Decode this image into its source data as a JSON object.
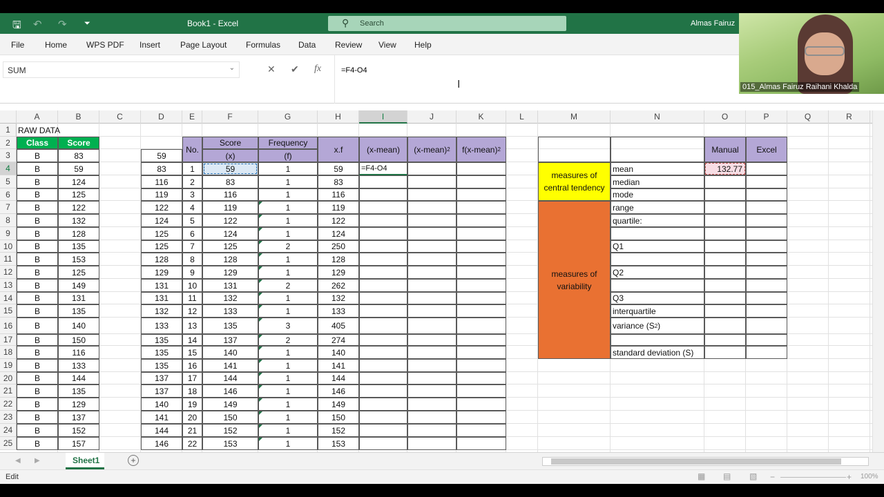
{
  "titlebar": {
    "title": "Book1  -  Excel",
    "search_placeholder": "Search",
    "user": "Almas Fairuz",
    "icons": [
      "save-icon",
      "undo-icon",
      "redo-icon",
      "customize-icon"
    ]
  },
  "menu": [
    "File",
    "Home",
    "WPS PDF",
    "Insert",
    "Page Layout",
    "Formulas",
    "Data",
    "Review",
    "View",
    "Help"
  ],
  "formula_bar": {
    "name_box": "SUM",
    "cancel": "✕",
    "enter": "✔",
    "fx": "fx",
    "formula": "=F4-O4"
  },
  "webcam": {
    "caption": "015_Almas Fairuz Raihani Khalda"
  },
  "columns": [
    "A",
    "B",
    "C",
    "D",
    "E",
    "F",
    "G",
    "H",
    "I",
    "J",
    "K",
    "L",
    "M",
    "N",
    "O",
    "P",
    "Q",
    "R"
  ],
  "selected_column": "I",
  "rows": [
    "1",
    "2",
    "3",
    "4",
    "5",
    "6",
    "7",
    "8",
    "9",
    "10",
    "11",
    "12",
    "13",
    "14",
    "15",
    "16",
    "17",
    "18",
    "19",
    "20",
    "21",
    "22",
    "23",
    "24",
    "25"
  ],
  "selected_row": "4",
  "raw": {
    "title": "RAW DATA",
    "class_header": "Class",
    "score_header": "Score",
    "classes": [
      "B",
      "B",
      "B",
      "B",
      "B",
      "B",
      "B",
      "B",
      "B",
      "B",
      "B",
      "B",
      "B",
      "B",
      "B",
      "B",
      "B",
      "B",
      "B",
      "B",
      "B",
      "B",
      "B"
    ],
    "scores": [
      "83",
      "59",
      "124",
      "125",
      "122",
      "132",
      "128",
      "135",
      "153",
      "125",
      "149",
      "131",
      "135",
      "140",
      "150",
      "116",
      "133",
      "144",
      "135",
      "129",
      "137",
      "152",
      "157"
    ]
  },
  "sorted": [
    "59",
    "83",
    "116",
    "119",
    "122",
    "124",
    "125",
    "125",
    "128",
    "129",
    "131",
    "131",
    "132",
    "133",
    "135",
    "135",
    "135",
    "137",
    "137",
    "140",
    "141",
    "144",
    "146"
  ],
  "freq": {
    "h_no": "No.",
    "h_score": "Score",
    "h_x": "(x)",
    "h_freq": "Frequency",
    "h_f": "(f)",
    "h_xf": "x.f",
    "h_xmean": "(x-mean)",
    "h_xmean2": "(x-mean)",
    "h_fxmean2": "f(x-mean)",
    "sup2": "2",
    "no": [
      "1",
      "2",
      "3",
      "4",
      "5",
      "6",
      "7",
      "8",
      "9",
      "10",
      "11",
      "12",
      "13",
      "14",
      "15",
      "16",
      "17",
      "18",
      "19",
      "20",
      "21",
      "22"
    ],
    "x": [
      "59",
      "83",
      "116",
      "119",
      "122",
      "124",
      "125",
      "128",
      "129",
      "131",
      "132",
      "133",
      "135",
      "137",
      "140",
      "141",
      "144",
      "146",
      "149",
      "150",
      "152",
      "153"
    ],
    "f": [
      "1",
      "1",
      "1",
      "1",
      "1",
      "1",
      "2",
      "1",
      "1",
      "2",
      "1",
      "1",
      "3",
      "2",
      "1",
      "1",
      "1",
      "1",
      "1",
      "1",
      "1",
      "1"
    ],
    "xf": [
      "59",
      "83",
      "116",
      "119",
      "122",
      "124",
      "250",
      "128",
      "129",
      "262",
      "132",
      "133",
      "405",
      "274",
      "140",
      "141",
      "144",
      "146",
      "149",
      "150",
      "152",
      "153"
    ],
    "active_cell": "=F4-O4"
  },
  "stats": {
    "h_manual": "Manual",
    "h_excel": "Excel",
    "central": "measures of central tendency",
    "variability": "measures of variability",
    "mean": "mean",
    "median": "median",
    "mode": "mode",
    "range": "range",
    "quartile": "quartile:",
    "q1": "Q1",
    "q2": "Q2",
    "q3": "Q3",
    "interquartile": "interquartile",
    "variance": "variance (S",
    "variance_end": ")",
    "stdev": "standard deviation (S)",
    "mean_manual": "132.77"
  },
  "sheets": {
    "tab": "Sheet1",
    "add": "+"
  },
  "status": {
    "mode": "Edit",
    "zoom": "100%"
  }
}
